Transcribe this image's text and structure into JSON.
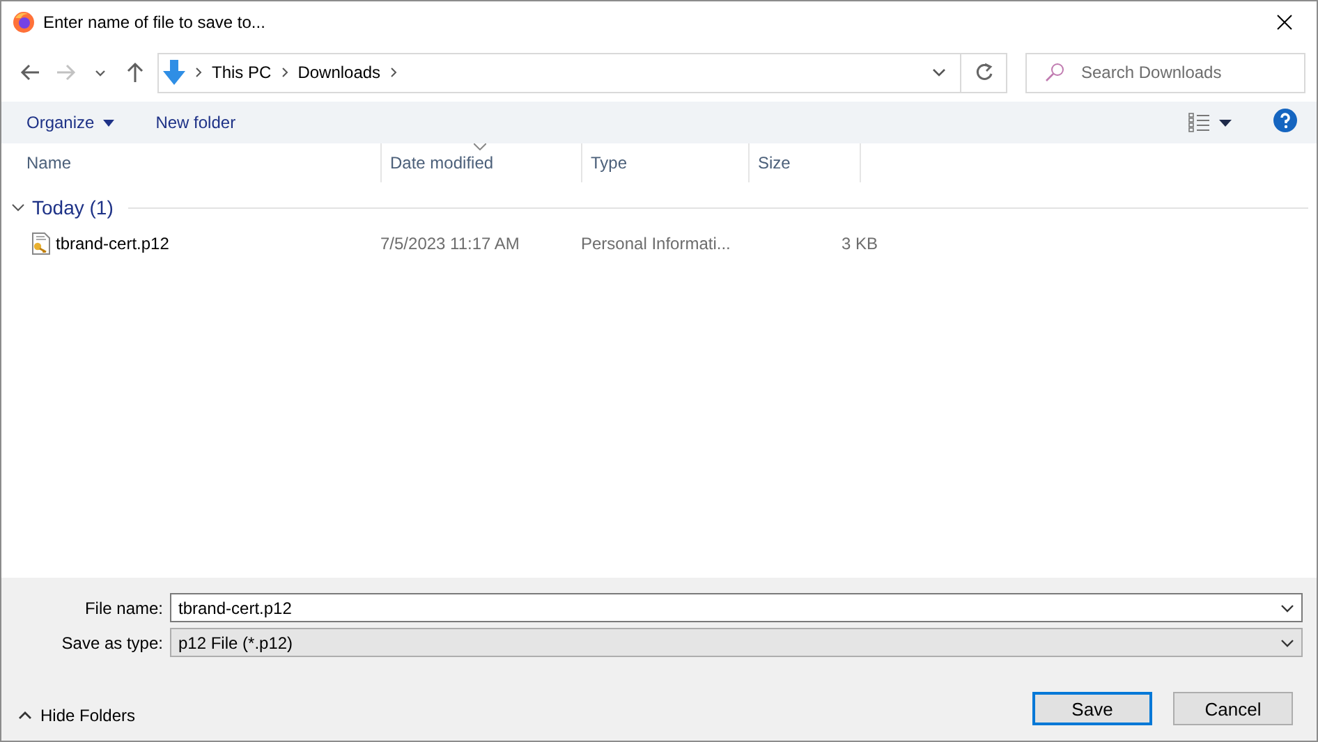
{
  "window": {
    "title": "Enter name of file to save to..."
  },
  "nav_buttons": [
    {
      "kind": "back",
      "disabled": false
    },
    {
      "kind": "forward",
      "disabled": true
    },
    {
      "kind": "recent",
      "disabled": false
    },
    {
      "kind": "up",
      "disabled": false
    }
  ],
  "breadcrumb": [
    "This PC",
    "Downloads"
  ],
  "search": {
    "placeholder": "Search Downloads"
  },
  "toolbar": {
    "organize": "Organize",
    "new_folder": "New folder"
  },
  "columns": [
    {
      "label": "Name",
      "sorted": false
    },
    {
      "label": "Date modified",
      "sorted": true
    },
    {
      "label": "Type",
      "sorted": false
    },
    {
      "label": "Size",
      "sorted": false
    }
  ],
  "groups": [
    {
      "label": "Today (1)",
      "expanded": true,
      "files": [
        {
          "name": "tbrand-cert.p12",
          "date": "7/5/2023 11:17 AM",
          "type": "Personal Informati...",
          "size": "3 KB"
        }
      ]
    }
  ],
  "form": {
    "file_name_label": "File name:",
    "file_name": "tbrand-cert.p12",
    "type_label": "Save as type:",
    "type": "p12 File (*.p12)"
  },
  "hide_folders": "Hide Folders",
  "buttons": [
    {
      "label": "Save",
      "default": true
    },
    {
      "label": "Cancel",
      "default": false
    }
  ]
}
